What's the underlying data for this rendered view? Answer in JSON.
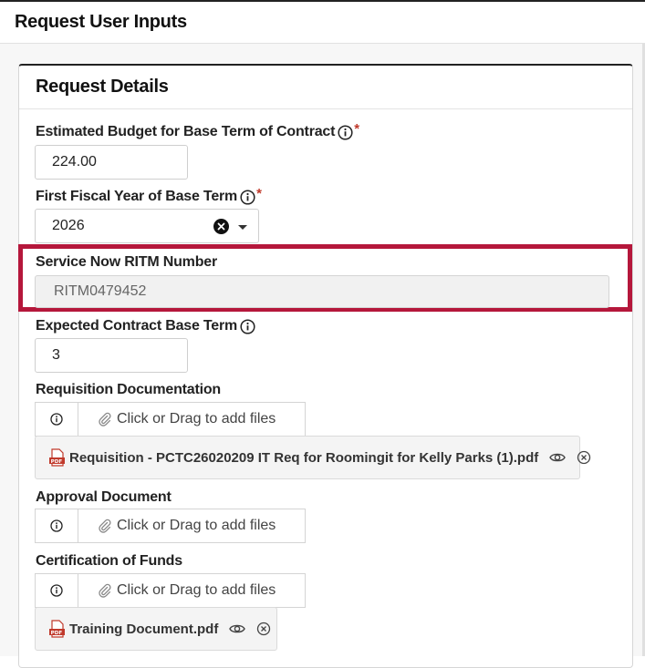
{
  "header": {
    "title": "Request User Inputs"
  },
  "card": {
    "title": "Request Details"
  },
  "fields": {
    "budget": {
      "label": "Estimated Budget for Base Term of Contract",
      "required": "*",
      "value": "224.00"
    },
    "fiscal_year": {
      "label": "First Fiscal Year of Base Term",
      "required": "*",
      "value": "2026"
    },
    "ritm": {
      "label": "Service Now RITM Number",
      "value": "RITM0479452"
    },
    "base_term": {
      "label": "Expected Contract Base Term",
      "value": "3"
    }
  },
  "uploads": {
    "requisition": {
      "label": "Requisition Documentation",
      "prompt": "Click or Drag to add files",
      "files": [
        "Requisition - PCTC26020209 IT Req for Roomingit for Kelly Parks (1).pdf"
      ]
    },
    "approval": {
      "label": "Approval Document",
      "prompt": "Click or Drag to add files",
      "files": []
    },
    "funds": {
      "label": "Certification of Funds",
      "prompt": "Click or Drag to add files",
      "files": [
        "Training Document.pdf"
      ]
    }
  },
  "colors": {
    "highlight": "#b5173b",
    "required": "#c0392b",
    "pdf_icon": "#c0392b"
  },
  "icons": [
    "info-icon",
    "clear-icon",
    "chevron-down-icon",
    "paperclip-icon",
    "pdf-icon",
    "eye-icon",
    "remove-icon"
  ]
}
